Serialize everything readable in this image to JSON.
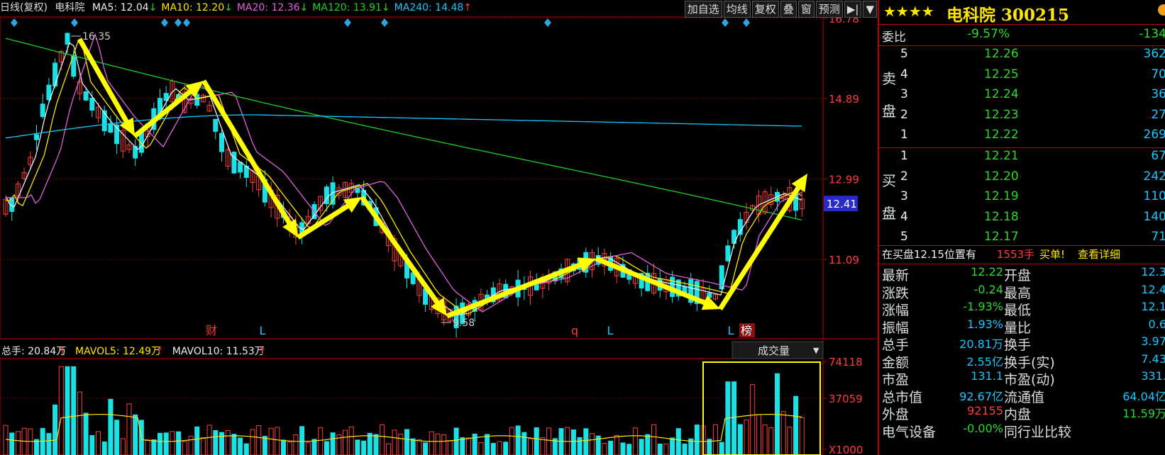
{
  "header": {
    "period": "日线(复权)",
    "name": "电科院",
    "ma": [
      {
        "label": "MA5: 12.04",
        "arrow": "↓",
        "color": "#eeeeee",
        "arrow_color": "#2bd92b"
      },
      {
        "label": "MA10: 12.20",
        "arrow": "↓",
        "color": "#ffe600",
        "arrow_color": "#2bd92b"
      },
      {
        "label": "MA20: 12.36",
        "arrow": "↓",
        "color": "#e060e0",
        "arrow_color": "#2bd92b"
      },
      {
        "label": "MA120: 13.91",
        "arrow": "↓",
        "color": "#19d11f",
        "arrow_color": "#2bd92b"
      },
      {
        "label": "MA240: 14.48",
        "arrow": "↑",
        "color": "#19c6ff",
        "arrow_color": "#ff3c3c"
      }
    ],
    "buttons": [
      "加自选",
      "均线",
      "复权",
      "叠",
      "窗",
      "预测",
      "▶|",
      "▼"
    ]
  },
  "chart_data": [
    {
      "type": "candlestick",
      "title": "日线(复权)",
      "y_ticks": [
        16.78,
        14.89,
        12.99,
        11.09
      ],
      "current_price_tag": 12.41,
      "high_label": "16.35",
      "low_label": "9.58",
      "event_markers": [
        "财",
        "L",
        "q",
        "L",
        "L",
        "榜"
      ],
      "colors": {
        "up": "#ff3c3c",
        "down": "#19e1e6",
        "ma5": "#eeeeee",
        "ma10": "#ffe600",
        "ma20": "#e060e0",
        "ma120": "#19d11f",
        "ma240": "#19c6ff",
        "annotation": "#ffff00"
      }
    },
    {
      "type": "bar",
      "title": "成交量",
      "legend": [
        {
          "label": "总手: 20.84万",
          "arrow": "↑",
          "color": "#eeeeee"
        },
        {
          "label": "MAVOL5: 12.49万",
          "arrow": "↑",
          "color": "#ffe600"
        },
        {
          "label": "MAVOL10: 11.53万",
          "arrow": "↑",
          "color": "#eeeeee"
        }
      ],
      "y_ticks": [
        "74118",
        "37059",
        "X1000"
      ],
      "selector": "成交量"
    }
  ],
  "quote": {
    "stars": "★★★★",
    "title": "电科院 300215",
    "weibi_label": "委比",
    "weibi_value": "-9.57%",
    "weibi_diff": "-134",
    "sell_label": [
      "卖",
      "盘"
    ],
    "buy_label": [
      "买",
      "盘"
    ],
    "sell": [
      {
        "lv": "5",
        "price": "12.26",
        "vol": "362"
      },
      {
        "lv": "4",
        "price": "12.25",
        "vol": "70"
      },
      {
        "lv": "3",
        "price": "12.24",
        "vol": "36"
      },
      {
        "lv": "2",
        "price": "12.23",
        "vol": "27"
      },
      {
        "lv": "1",
        "price": "12.22",
        "vol": "269"
      }
    ],
    "buy": [
      {
        "lv": "1",
        "price": "12.21",
        "vol": "67"
      },
      {
        "lv": "2",
        "price": "12.20",
        "vol": "242"
      },
      {
        "lv": "3",
        "price": "12.19",
        "vol": "110"
      },
      {
        "lv": "4",
        "price": "12.18",
        "vol": "140"
      },
      {
        "lv": "5",
        "price": "12.17",
        "vol": "71"
      }
    ],
    "notice_a": "在买盘12.15位置有",
    "notice_b": "1553手",
    "notice_c": "买单!",
    "notice_d": "查看详细",
    "stats": [
      {
        "k1": "最新",
        "v1": "12.22",
        "k2": "开盘",
        "v2": "12.3"
      },
      {
        "k1": "涨跌",
        "v1": "-0.24",
        "k2": "最高",
        "v2": "12.4"
      },
      {
        "k1": "涨幅",
        "v1": "-1.93%",
        "k2": "最低",
        "v2": "12.1"
      },
      {
        "k1": "振幅",
        "v1": "1.93%",
        "k2": "量比",
        "v2": "0.6"
      },
      {
        "k1": "总手",
        "v1": "20.81万",
        "k2": "换手",
        "v2": "3.97"
      },
      {
        "k1": "金额",
        "v1": "2.55亿",
        "k2": "换手(实)",
        "v2": "7.43"
      },
      {
        "k1": "市盈",
        "v1": "131.1",
        "k2": "市盈(动)",
        "v2": "331."
      },
      {
        "k1": "总市值",
        "v1": "92.67亿",
        "k2": "流通值",
        "v2": "64.04亿"
      },
      {
        "k1": "外盘",
        "v1": "92155",
        "k2": "内盘",
        "v2": "11.59万"
      },
      {
        "k1": "电气设备",
        "v1": "-0.00%",
        "k2": "同行业比较",
        "v2": ""
      }
    ]
  }
}
